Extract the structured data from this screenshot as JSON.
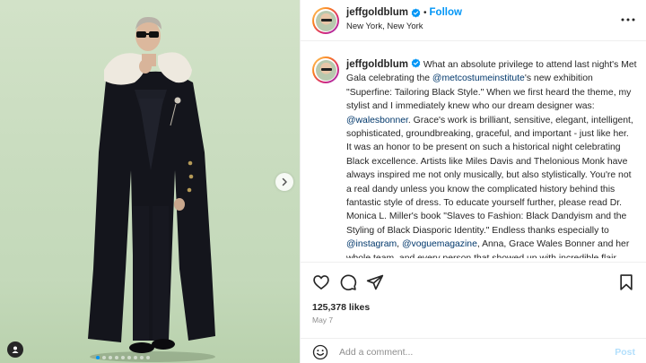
{
  "photo": {
    "carousel_total": 9,
    "carousel_active_index": 0
  },
  "header": {
    "username": "jeffgoldblum",
    "separator": "•",
    "follow_label": "Follow",
    "location": "New York, New York"
  },
  "caption": {
    "username": "jeffgoldblum",
    "segments_p1": [
      {
        "t": " What an absolute privilege to attend last night's Met Gala celebrating the "
      },
      {
        "t": "@metcostumeinstitute",
        "m": true
      },
      {
        "t": "'s new exhibition \"Superfine: Tailoring Black Style.\" When we first heard the theme, my stylist and I immediately knew who our dream designer was: "
      },
      {
        "t": "@walesbonner",
        "m": true
      },
      {
        "t": ". Grace's work is brilliant, sensitive, elegant, intelligent, sophisticated, groundbreaking, graceful, and important - just like her."
      }
    ],
    "segments_p2": [
      {
        "t": "It was an honor to be present on such a historical night celebrating Black excellence. Artists like Miles Davis and Thelonious Monk have always inspired me not only musically, but also stylistically. You're not a real dandy unless you know the complicated history behind this fantastic style of dress. To educate yourself further, please read Dr. Monica L. Miller's book \"Slaves to Fashion: Black Dandyism and the Styling of Black Diasporic Identity.\" Endless thanks especially to "
      },
      {
        "t": "@instagram",
        "m": true
      },
      {
        "t": ", "
      },
      {
        "t": "@voguemagazine",
        "m": true
      },
      {
        "t": ", Anna, Grace Wales Bonner and her whole team, and every person that showed up with incredible flair"
      }
    ]
  },
  "engagement": {
    "likes": "125,378 likes",
    "date": "May 7"
  },
  "comment": {
    "placeholder": "Add a comment...",
    "post_label": "Post"
  },
  "colors": {
    "accent": "#0095f6",
    "mention": "#00376b",
    "post_disabled": "#b2dffc",
    "photo_bg": "#c7dbbd"
  }
}
